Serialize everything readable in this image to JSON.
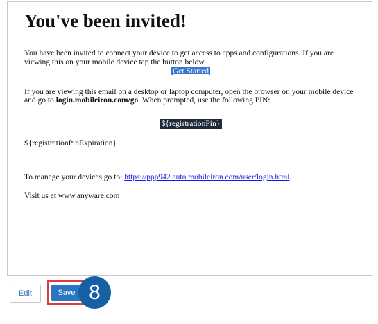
{
  "email": {
    "heading": "You've been invited!",
    "intro_text": "You have been invited to connect your device to get access to apps and configurations. If you are viewing this on your mobile device tap the button below.",
    "get_started_label": "Get Started",
    "desktop_text_before": "If you are viewing this email on a desktop or laptop computer, open the browser on your mobile device and go to ",
    "desktop_link_bold": "login.mobileiron.com/go",
    "desktop_text_after": ". When prompted, use the following PIN:",
    "registration_pin": "${registrationPin}",
    "registration_pin_expiration": "${registrationPinExpiration}",
    "manage_text": "To manage your devices go to: ",
    "manage_link": "https://ppp942.auto.mobileiron.com/user/login.html",
    "manage_text_after": ".",
    "visit_text": "Visit us at www.anyware.com"
  },
  "footer": {
    "edit_label": "Edit",
    "save_label": "Save"
  },
  "annotation": {
    "step_number": "8"
  },
  "colors": {
    "save_button": "#2b76c0",
    "highlight_border": "#e03a3a",
    "step_badge": "#1760a4",
    "get_started_bg": "#3a78d0",
    "pin_bg": "#1f2a3b",
    "link": "#1a1ae6"
  }
}
